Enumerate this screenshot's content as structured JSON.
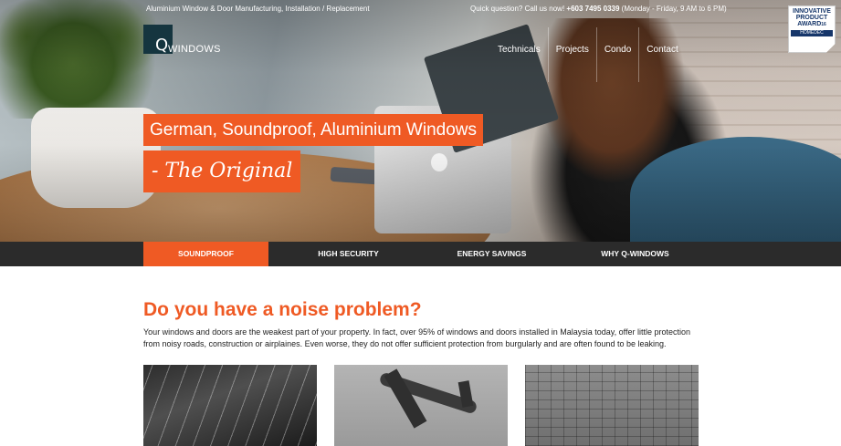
{
  "topbar": {
    "tagline": "Aluminium Window & Door Manufacturing, Installation / Replacement",
    "contact_prefix": "Quick question? Call us now! ",
    "phone": "+603 7495 0339",
    "hours": " (Monday - Friday, 9 AM to 6 PM)"
  },
  "logo": {
    "letter": "Q",
    "text": "WINDOWS"
  },
  "nav": {
    "items": [
      {
        "label": "Technicals"
      },
      {
        "label": "Projects"
      },
      {
        "label": "Condo"
      },
      {
        "label": "Contact"
      }
    ]
  },
  "award": {
    "line1": "INNOVATIVE",
    "line2": "PRODUCT",
    "line3": "AWARD",
    "year": "16",
    "brand": "HOMEDEC"
  },
  "hero": {
    "headline": "German, Soundproof, Aluminium Windows",
    "tagline": "- The Original"
  },
  "tabs": [
    {
      "label": "SOUNDPROOF",
      "active": true
    },
    {
      "label": "HIGH SECURITY",
      "active": false
    },
    {
      "label": "ENERGY SAVINGS",
      "active": false
    },
    {
      "label": "WHY Q-WINDOWS",
      "active": false
    }
  ],
  "content": {
    "heading": "Do you have a noise problem?",
    "intro": "Your windows and doors are the weakest part of your property. In fact, over 95% of windows and doors installed in Malaysia today, offer little protection from noisy roads, construction or airplaines. Even worse, they do not offer sufficient protection from burgularly and are often found to be leaking."
  },
  "colors": {
    "accent": "#ef5a24",
    "tabbar": "#2b2b2b",
    "logo_bg": "#15353f"
  }
}
